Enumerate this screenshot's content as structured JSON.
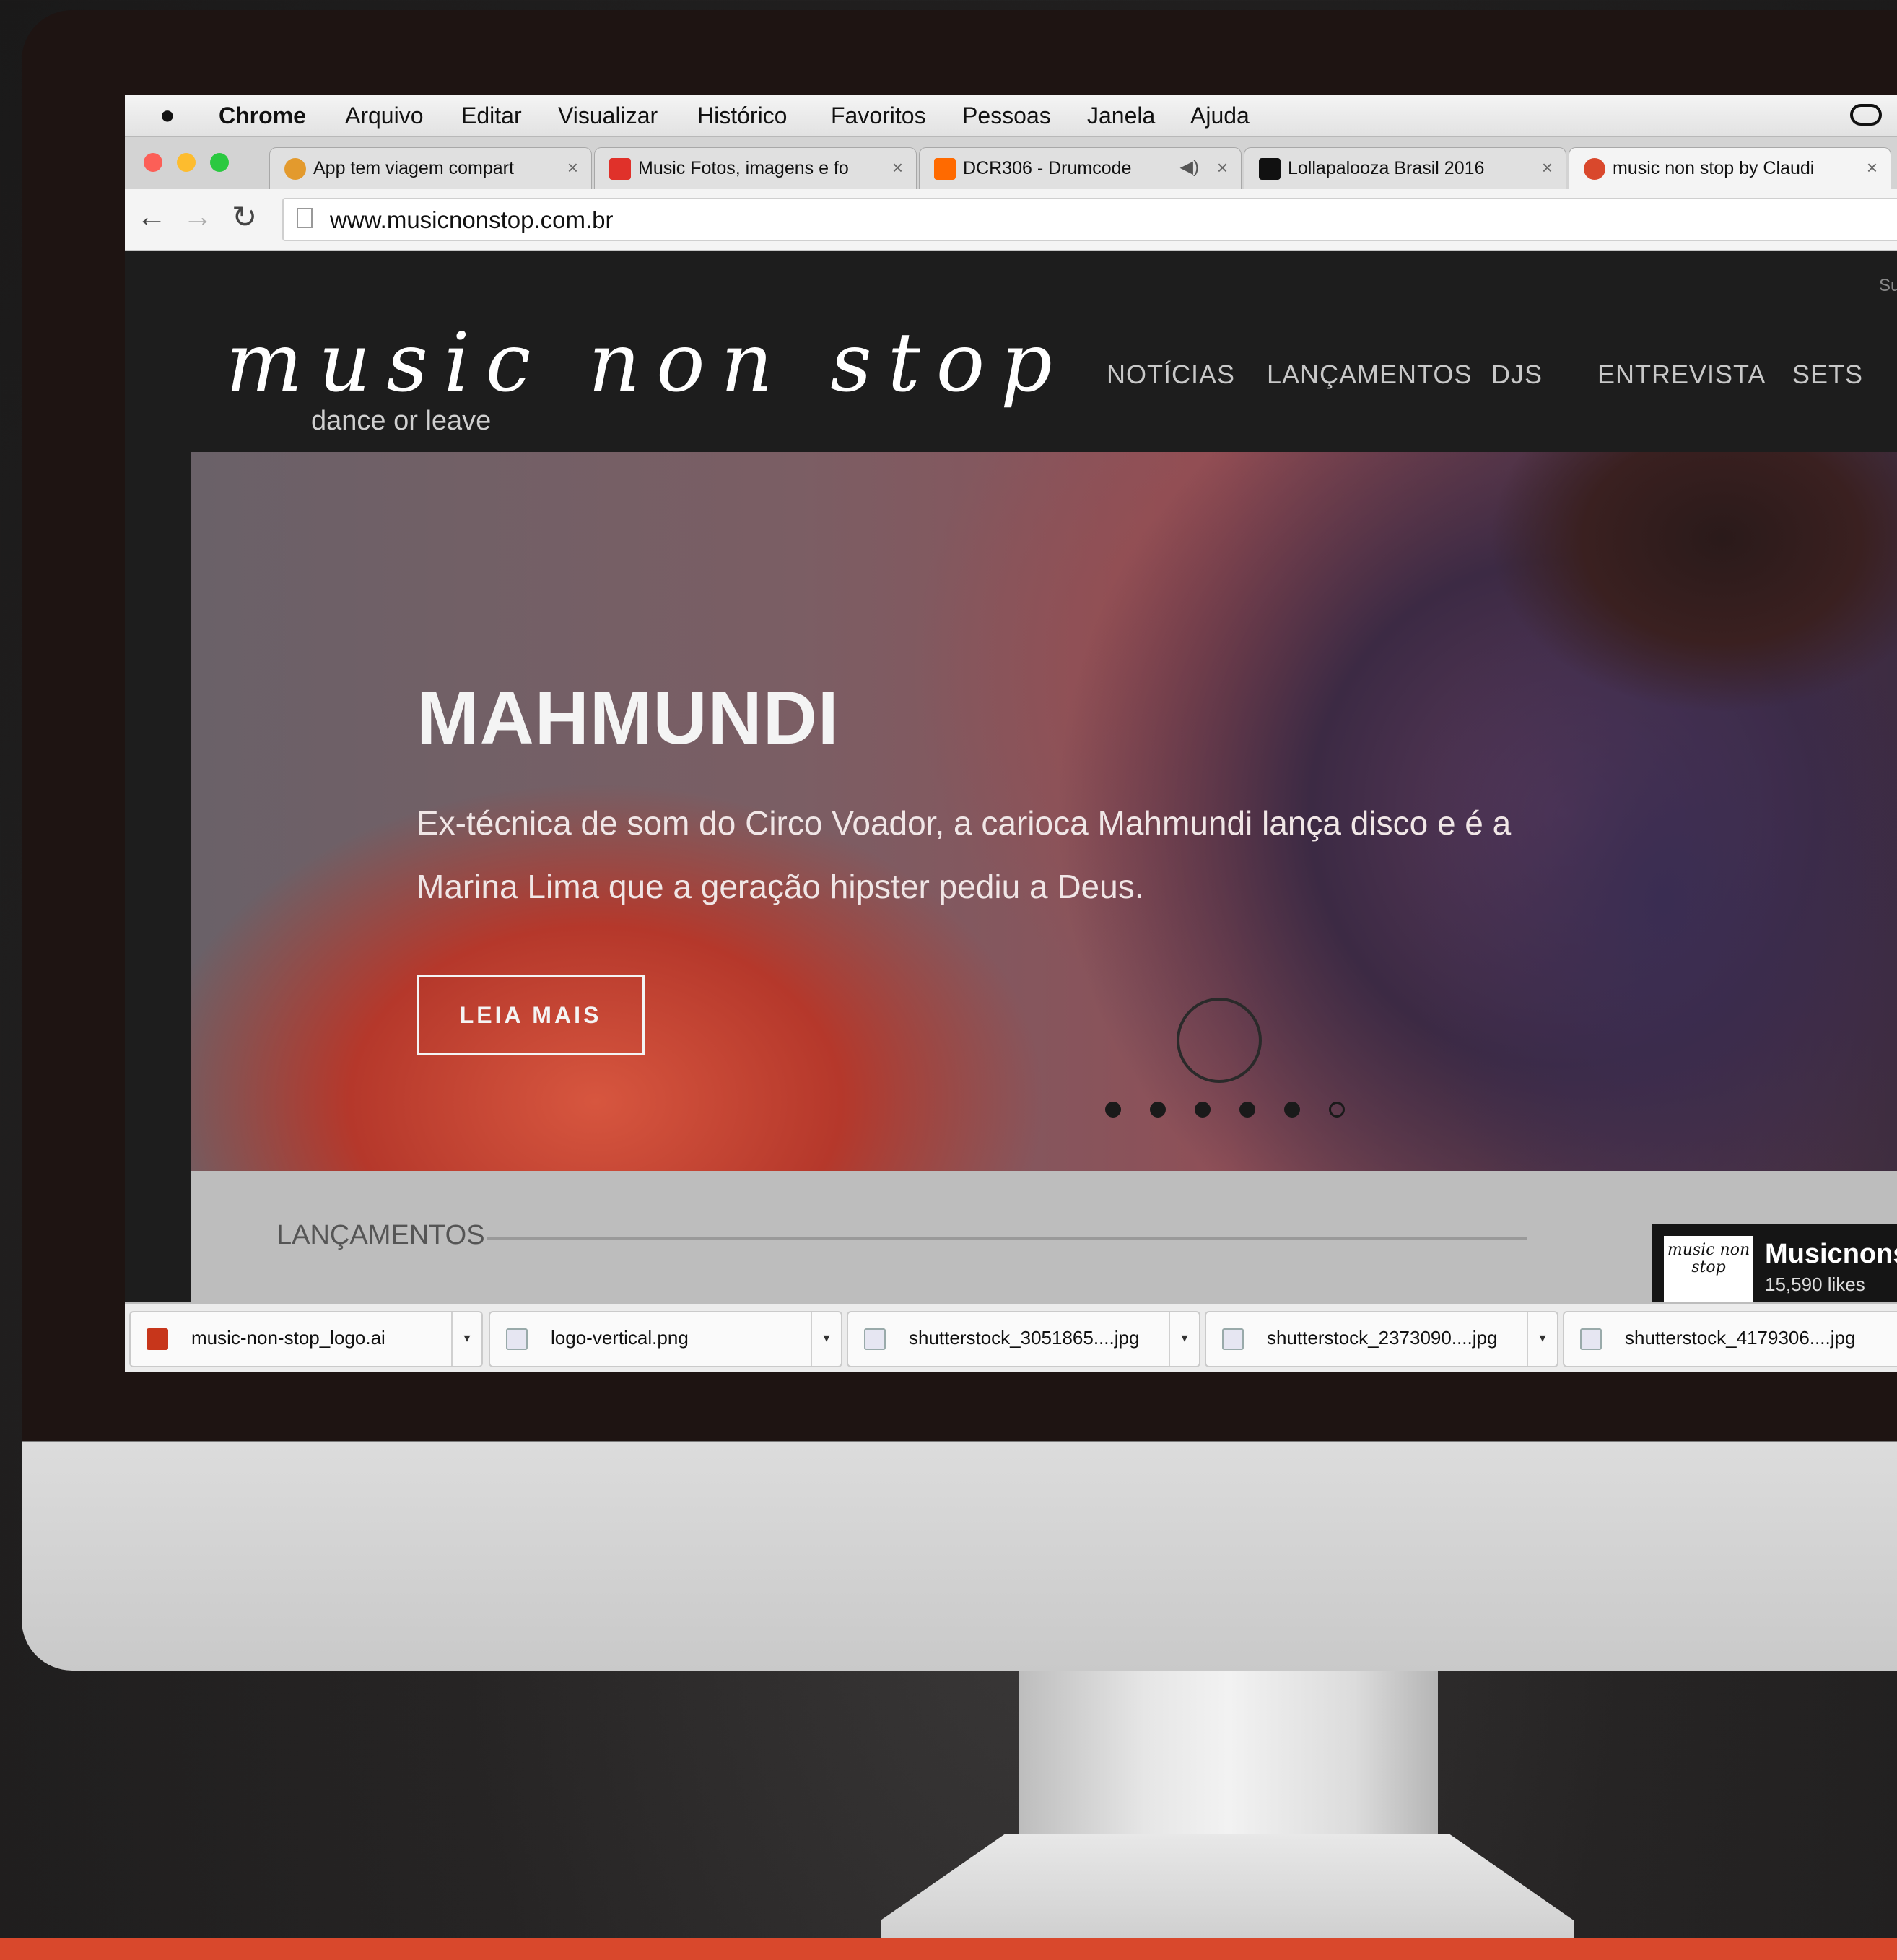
{
  "colors": {
    "accent": "#d9482c",
    "site_bg": "#1d1d1d",
    "releases_bg": "#bdbdbd"
  },
  "menubar": {
    "apple_icon": "apple-icon",
    "app_name": "Chrome",
    "items": [
      "Arquivo",
      "Editar",
      "Visualizar",
      "Histórico",
      "Favoritos",
      "Pessoas",
      "Janela",
      "Ajuda"
    ],
    "status_icon": "creative-cloud-icon"
  },
  "tabs": [
    {
      "title": "App tem viagem compart",
      "favicon": "tripadvisor-icon"
    },
    {
      "title": "Music Fotos, imagens e fo",
      "favicon": "photo-site-icon"
    },
    {
      "title": "DCR306 - Drumcode",
      "favicon": "soundcloud-icon",
      "audio": "speaker-icon"
    },
    {
      "title": "Lollapalooza Brasil 2016",
      "favicon": "lollapalooza-icon"
    },
    {
      "title": "music non stop by Claudi",
      "favicon": "music-site-icon",
      "active": true
    }
  ],
  "toolbar": {
    "url": "www.musicnonstop.com.br"
  },
  "site": {
    "logo": "music non stop",
    "tagline": "dance or leave",
    "top_right": "Su",
    "nav": [
      "NOTÍCIAS",
      "LANÇAMENTOS",
      "DJS",
      "ENTREVISTA",
      "SETS"
    ],
    "hero": {
      "title": "MAHMUNDI",
      "description": "Ex-técnica de som do Circo Voador, a carioca Mahmundi lança disco e é a Marina Lima que a geração hipster pediu a Deus.",
      "button": "LEIA MAIS",
      "slides": 6,
      "current_slide": 6
    },
    "releases": {
      "label": "LANÇAMENTOS",
      "facebook": {
        "name": "Musicnonstop",
        "likes": "15,590 likes",
        "logo_text": "music non stop"
      }
    }
  },
  "downloads": [
    {
      "name": "music-non-stop_logo.ai",
      "icon": "illustrator-file-icon"
    },
    {
      "name": "logo-vertical.png",
      "icon": "image-file-icon"
    },
    {
      "name": "shutterstock_3051865....jpg",
      "icon": "image-file-icon"
    },
    {
      "name": "shutterstock_2373090....jpg",
      "icon": "image-file-icon"
    },
    {
      "name": "shutterstock_4179306....jpg",
      "icon": "image-file-icon"
    }
  ]
}
